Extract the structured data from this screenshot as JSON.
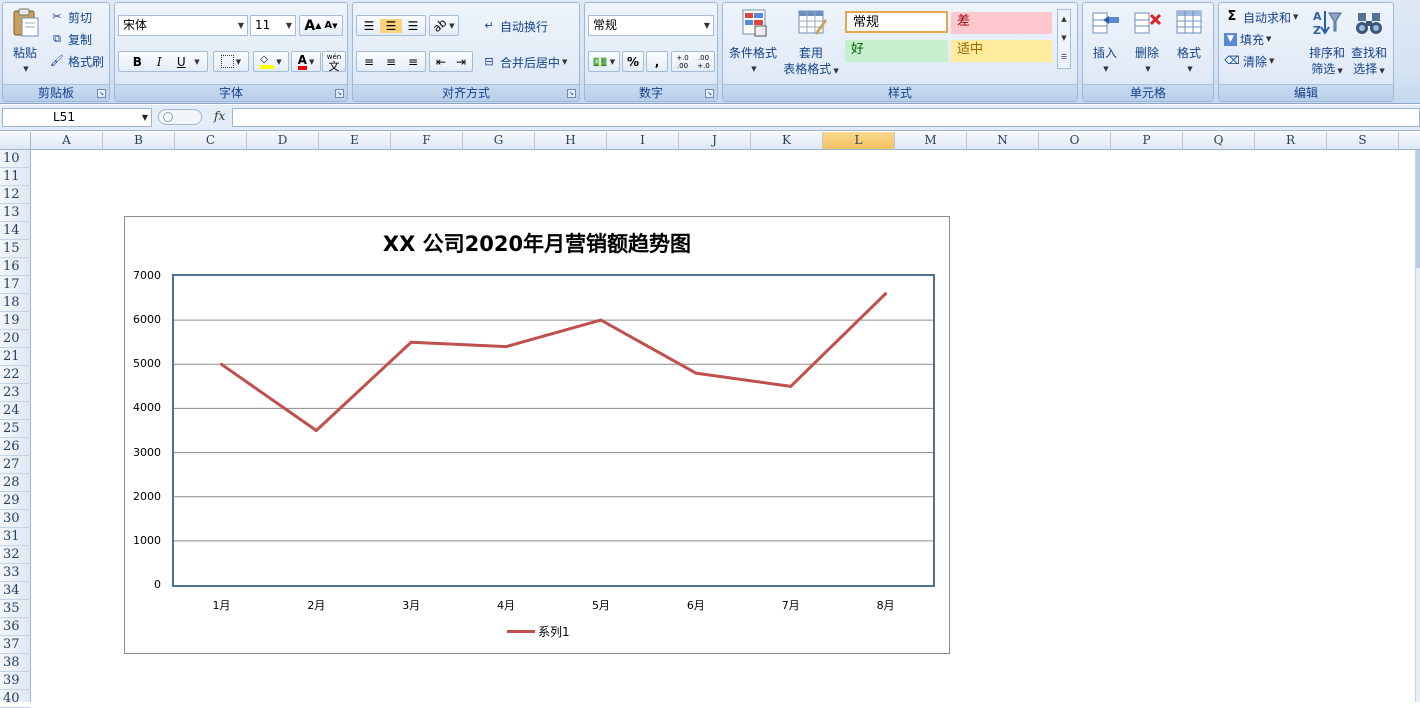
{
  "ribbon": {
    "clipboard": {
      "paste": "粘贴",
      "cut": "剪切",
      "copy": "复制",
      "format_painter": "格式刷",
      "label": "剪贴板"
    },
    "font": {
      "name": "宋体",
      "size": "11",
      "bold": "B",
      "italic": "I",
      "underline": "U",
      "grow": "A",
      "shrink": "A",
      "phonetic": "wén",
      "phonetic_char": "文",
      "label": "字体"
    },
    "alignment": {
      "wrap_text": "自动换行",
      "merge_center": "合并后居中",
      "label": "对齐方式"
    },
    "number": {
      "format": "常规",
      "percent": "%",
      "comma": ",",
      "inc_dec": "+.0 .00",
      "dec_dec": ".00 +.0",
      "label": "数字"
    },
    "styles": {
      "conditional": "条件格式",
      "table_line1": "套用",
      "table_line2": "表格格式",
      "normal": "常规",
      "bad": "差",
      "good": "好",
      "neutral": "适中",
      "label": "样式"
    },
    "cells": {
      "insert": "插入",
      "delete": "删除",
      "format": "格式",
      "label": "单元格"
    },
    "editing": {
      "autosum": "自动求和",
      "fill": "填充",
      "clear": "清除",
      "sort_line1": "排序和",
      "sort_line2": "筛选",
      "find_line1": "查找和",
      "find_line2": "选择",
      "label": "编辑"
    }
  },
  "formula_bar": {
    "name_box": "L51",
    "fx": "fx",
    "value": ""
  },
  "grid": {
    "columns": [
      "A",
      "B",
      "C",
      "D",
      "E",
      "F",
      "G",
      "H",
      "I",
      "J",
      "K",
      "L",
      "M",
      "N",
      "O",
      "P",
      "Q",
      "R",
      "S"
    ],
    "selected_column": "L",
    "rows": [
      "10",
      "11",
      "12",
      "13",
      "14",
      "15",
      "16",
      "17",
      "18",
      "19",
      "20",
      "21",
      "22",
      "23",
      "24",
      "25",
      "26",
      "27",
      "28",
      "29",
      "30",
      "31",
      "32",
      "33",
      "34",
      "35",
      "36",
      "37",
      "38",
      "39",
      "40"
    ]
  },
  "colors": {
    "series": "#c0504d",
    "plot_border": "#4f6f94",
    "selected_header": "#f6c160"
  },
  "chart_data": {
    "type": "line",
    "title": "XX 公司2020年月营销额趋势图",
    "categories": [
      "1月",
      "2月",
      "3月",
      "4月",
      "5月",
      "6月",
      "7月",
      "8月"
    ],
    "series": [
      {
        "name": "系列1",
        "values": [
          5000,
          3500,
          5500,
          5400,
          6000,
          4800,
          4500,
          6600
        ]
      }
    ],
    "ylim": [
      0,
      7000
    ],
    "yticks": [
      "0",
      "1000",
      "2000",
      "3000",
      "4000",
      "5000",
      "6000",
      "7000"
    ],
    "grid": true,
    "legend": "bottom"
  }
}
